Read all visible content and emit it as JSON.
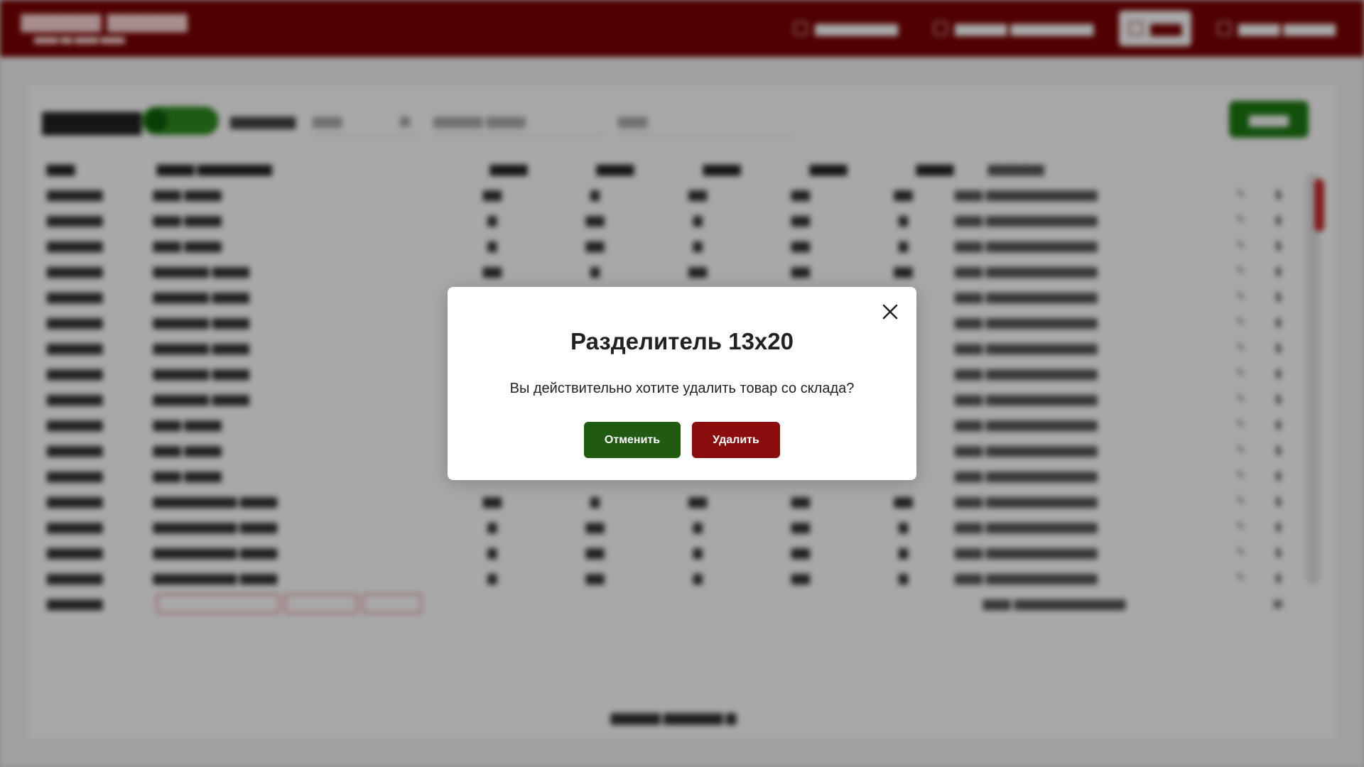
{
  "modal": {
    "title": "Разделитель 13х20",
    "message": "Вы действительно хотите удалить товар со склада?",
    "cancel_label": "Отменить",
    "delete_label": "Удалить",
    "close_icon": "close-icon"
  },
  "colors": {
    "header_bg": "#7a0000",
    "cancel_button": "#215a11",
    "delete_button": "#8b0c0c",
    "add_button": "#1d7a12"
  }
}
